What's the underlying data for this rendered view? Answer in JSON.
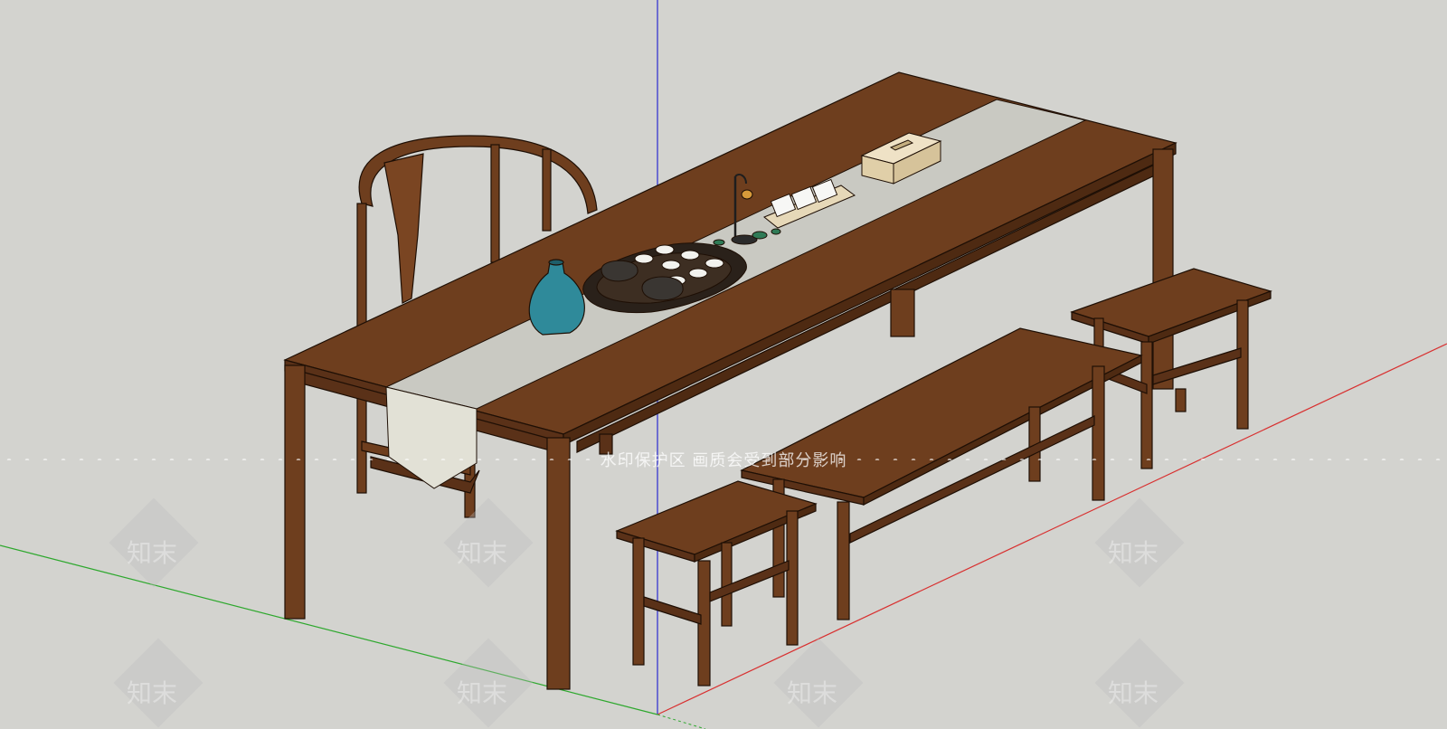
{
  "app": {
    "name": "SketchUp 3D model viewport"
  },
  "watermark": {
    "banner_text": "水印保护区   画质会受到部分影响",
    "tile_text": "知末"
  },
  "colors": {
    "background": "#d3d3cf",
    "wood": "#6e3e1e",
    "wood_dark": "#5a3118",
    "runner": "#c9c9c2",
    "vase": "#2f8a9a",
    "axis_red": "#d83030",
    "axis_green": "#2ea82e",
    "axis_blue": "#2a2ad0",
    "tissue_box": "#e8d7b8"
  },
  "scene": {
    "objects": [
      "tea-table",
      "armchair",
      "table-runner",
      "vase",
      "tea-tray",
      "teapot",
      "teacups",
      "incense-burner",
      "cup-tray",
      "tissue-box",
      "bench",
      "stool-front",
      "stool-back"
    ]
  }
}
